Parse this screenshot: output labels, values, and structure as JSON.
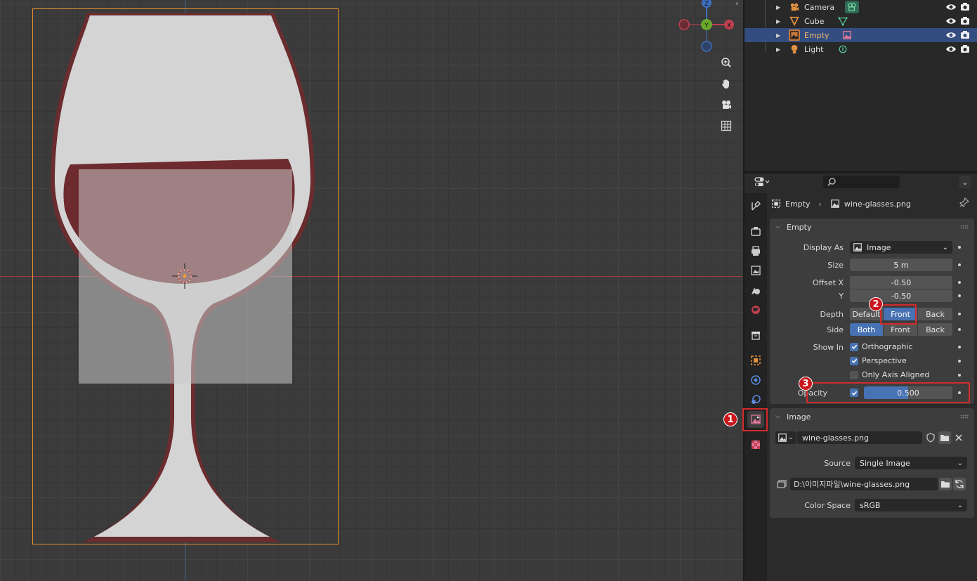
{
  "viewport": {
    "gizmo": {
      "z": "Z",
      "y": "Y",
      "x": "X"
    },
    "nav_icons": [
      "zoom-icon",
      "hand-icon",
      "camera-icon",
      "grid-icon"
    ]
  },
  "outliner": {
    "rows": [
      {
        "name": "Camera",
        "icon": "camera-object-icon",
        "data_icon": "camera-data-icon"
      },
      {
        "name": "Cube",
        "icon": "mesh-object-icon",
        "data_icon": "mesh-data-icon"
      },
      {
        "name": "Empty",
        "icon": "image-empty-icon",
        "data_icon": "image-data-icon",
        "selected": true
      },
      {
        "name": "Light",
        "icon": "light-object-icon",
        "data_icon": "light-data-icon"
      }
    ]
  },
  "properties": {
    "breadcrumb": {
      "object": "Empty",
      "data": "wine-glasses.png"
    },
    "empty_panel": {
      "title": "Empty",
      "display_as_label": "Display As",
      "display_as_value": "Image",
      "size_label": "Size",
      "size_value": "5 m",
      "offset_x_label": "Offset X",
      "offset_x_value": "-0.50",
      "offset_y_label": "Y",
      "offset_y_value": "-0.50",
      "depth_label": "Depth",
      "depth_options": [
        "Default",
        "Front",
        "Back"
      ],
      "depth_selected": "Front",
      "side_label": "Side",
      "side_options": [
        "Both",
        "Front",
        "Back"
      ],
      "side_selected": "Both",
      "show_in_label": "Show In",
      "orthographic_label": "Orthographic",
      "perspective_label": "Perspective",
      "only_axis_label": "Only Axis Aligned",
      "opacity_label": "Opacity",
      "opacity_value": "0.500",
      "opacity_fraction": 0.5
    },
    "image_panel": {
      "title": "Image",
      "image_name": "wine-glasses.png",
      "source_label": "Source",
      "source_value": "Single Image",
      "filepath": "D:\\이미지파일\\wine-glasses.png",
      "color_space_label": "Color Space",
      "color_space_value": "sRGB"
    }
  },
  "annotations": {
    "badge1": "1",
    "badge2": "2",
    "badge3": "3"
  },
  "colors": {
    "accent": "#4772b3",
    "selection": "#334d80",
    "highlight": "#d32a2a",
    "frame": "#e8922e"
  }
}
